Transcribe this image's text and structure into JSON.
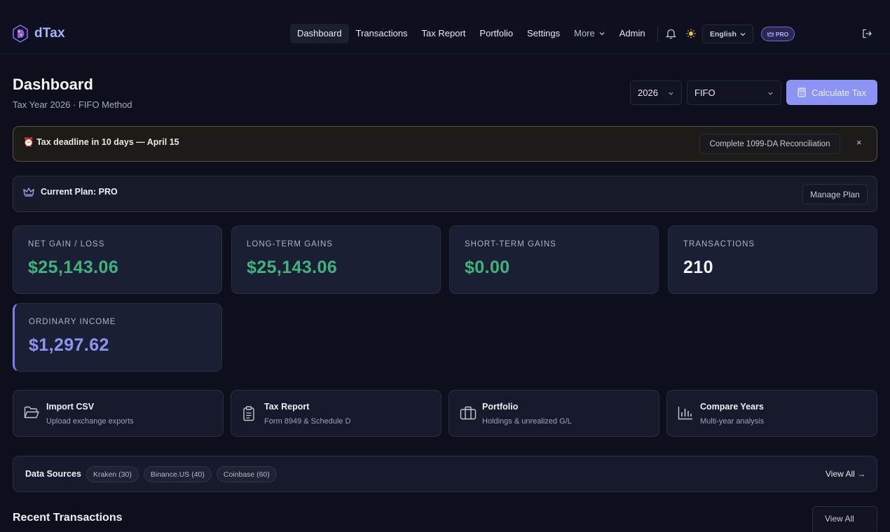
{
  "brand": {
    "name": "dTax",
    "logo_icon": "hexagon-d-logo"
  },
  "nav": {
    "items": [
      {
        "label": "Dashboard",
        "active": true
      },
      {
        "label": "Transactions"
      },
      {
        "label": "Tax Report"
      },
      {
        "label": "Portfolio"
      },
      {
        "label": "Settings"
      },
      {
        "label": "More",
        "dropdown": true
      },
      {
        "label": "Admin"
      }
    ],
    "language": "English",
    "plan_badge": "PRO"
  },
  "header": {
    "title": "Dashboard",
    "subtitle": "Tax Year 2026 · FIFO Method",
    "year_select": "2026",
    "method_select": "FIFO",
    "calculate_label": "Calculate Tax"
  },
  "alert": {
    "emoji": "⏰",
    "text": "Tax deadline in 10 days — April 15",
    "action_label": "Complete 1099-DA Reconciliation",
    "close": "×"
  },
  "plan": {
    "text": "Current Plan: PRO",
    "manage_label": "Manage Plan"
  },
  "stats": [
    {
      "label": "NET GAIN / LOSS",
      "value": "$25,143.06",
      "color": "#3fb37f"
    },
    {
      "label": "LONG-TERM GAINS",
      "value": "$25,143.06",
      "color": "#3fb37f"
    },
    {
      "label": "SHORT-TERM GAINS",
      "value": "$0.00",
      "color": "#3fb37f"
    },
    {
      "label": "TRANSACTIONS",
      "value": "210",
      "color": "#f3f4f8"
    },
    {
      "label": "ORDINARY INCOME",
      "value": "$1,297.62",
      "color": "#8e94f1"
    }
  ],
  "quick_actions": [
    {
      "title": "Import CSV",
      "subtitle": "Upload exchange exports",
      "icon": "folder-open-icon"
    },
    {
      "title": "Tax Report",
      "subtitle": "Form 8949 & Schedule D",
      "icon": "clipboard-icon"
    },
    {
      "title": "Portfolio",
      "subtitle": "Holdings & unrealized G/L",
      "icon": "briefcase-icon"
    },
    {
      "title": "Compare Years",
      "subtitle": "Multi-year analysis",
      "icon": "bar-chart-icon"
    }
  ],
  "data_sources": {
    "title": "Data Sources",
    "chips": [
      "Kraken (30)",
      "Binance.US (40)",
      "Coinbase (60)"
    ],
    "view_all_label": "View All →"
  },
  "recent": {
    "title": "Recent Transactions",
    "view_all_label": "View All"
  },
  "colors": {
    "accent": "#8b93f3",
    "gain": "#3fb37f",
    "income": "#8e94f1",
    "alert_border": "#5f5435"
  }
}
